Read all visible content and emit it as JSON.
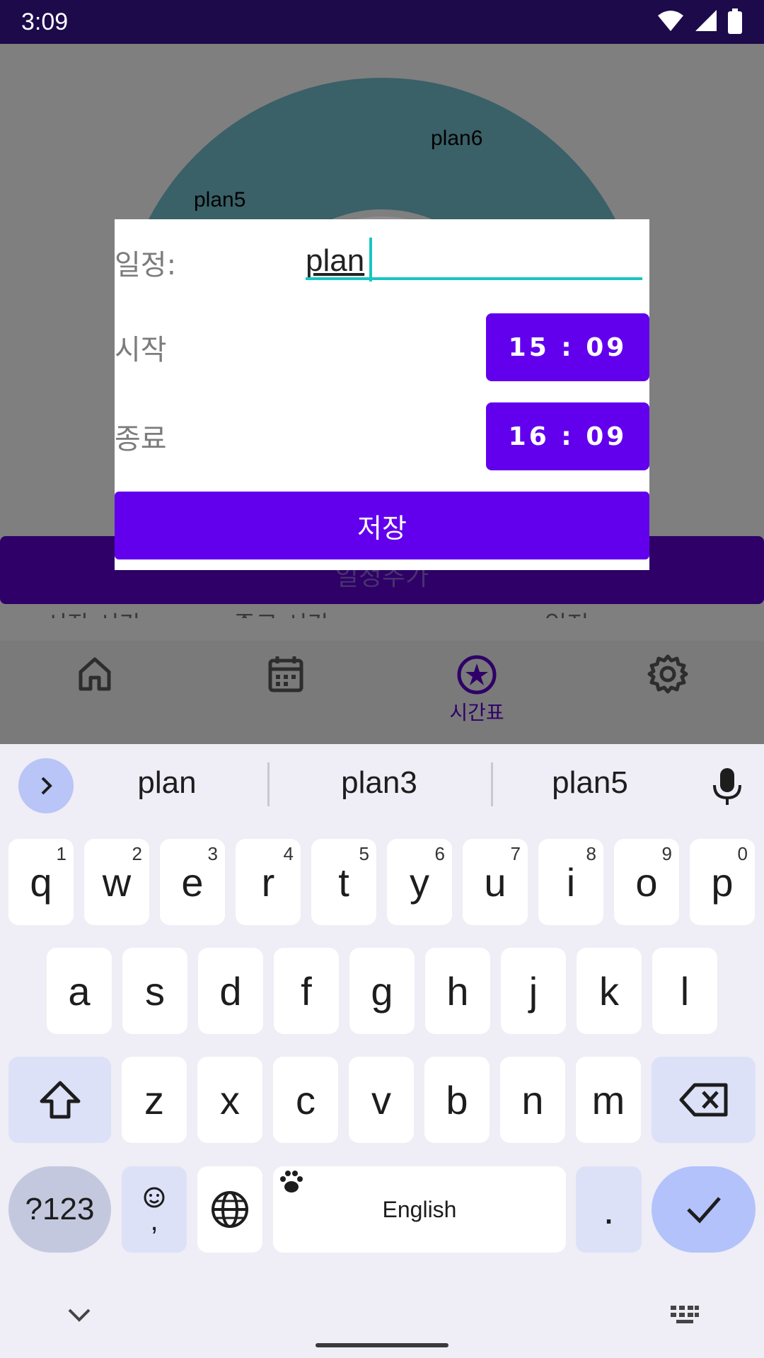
{
  "status_bar": {
    "time": "3:09"
  },
  "chart": {
    "labels": [
      "plan6",
      "plan5"
    ]
  },
  "background": {
    "share_button_label": "일정추가",
    "columns": [
      "시작 시간",
      "종료 시간",
      "일정"
    ]
  },
  "bottom_nav": {
    "items": [
      {
        "icon": "home-icon",
        "label": ""
      },
      {
        "icon": "calendar-icon",
        "label": ""
      },
      {
        "icon": "star-circle-icon",
        "label": "시간표",
        "selected": true
      },
      {
        "icon": "gear-icon",
        "label": ""
      }
    ]
  },
  "dialog": {
    "plan_label": "일정:",
    "plan_value": "plan",
    "start_label": "시작",
    "start_time": "15 : 09",
    "end_label": "종료",
    "end_time": "16 : 09",
    "save_label": "저장"
  },
  "keyboard": {
    "suggestions": [
      "plan",
      "plan3",
      "plan5"
    ],
    "row1": [
      {
        "k": "q",
        "h": "1"
      },
      {
        "k": "w",
        "h": "2"
      },
      {
        "k": "e",
        "h": "3"
      },
      {
        "k": "r",
        "h": "4"
      },
      {
        "k": "t",
        "h": "5"
      },
      {
        "k": "y",
        "h": "6"
      },
      {
        "k": "u",
        "h": "7"
      },
      {
        "k": "i",
        "h": "8"
      },
      {
        "k": "o",
        "h": "9"
      },
      {
        "k": "p",
        "h": "0"
      }
    ],
    "row2": [
      "a",
      "s",
      "d",
      "f",
      "g",
      "h",
      "j",
      "k",
      "l"
    ],
    "row3": [
      "z",
      "x",
      "c",
      "v",
      "b",
      "n",
      "m"
    ],
    "symbols_label": "?123",
    "emoji_comma": ",",
    "space_label": "English",
    "period_label": "."
  },
  "colors": {
    "accent": "#6200ee",
    "input_underline": "#18c6c0",
    "status_bar": "#1c0a4a"
  }
}
